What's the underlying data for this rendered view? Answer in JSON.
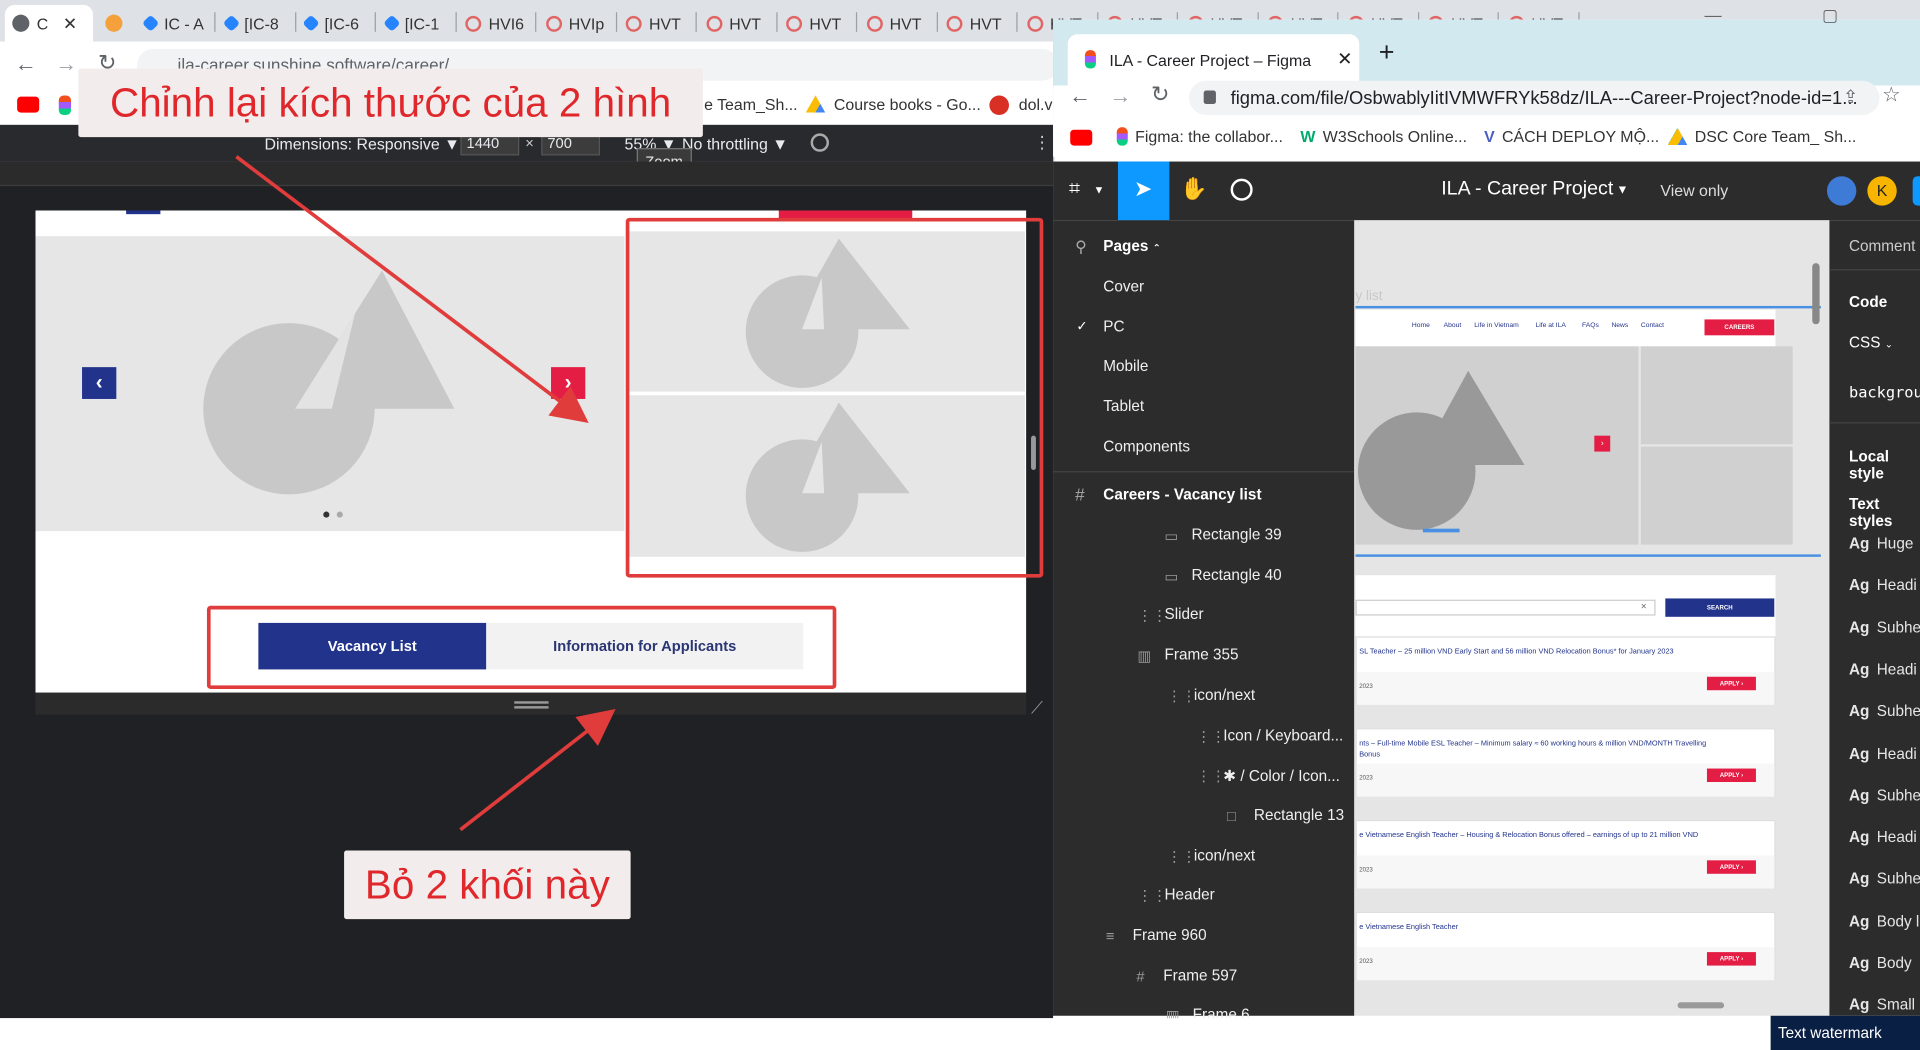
{
  "colors": {
    "accent_red": "#e03c3c",
    "navy": "#22338c",
    "pink": "#e41d44",
    "figma_dark": "#2c2c2c"
  },
  "left_browser": {
    "tabs": [
      "C",
      "IC - A",
      "[IC-8",
      "[IC-6",
      "[IC-1",
      "HVI6",
      "HVIp",
      "HVT",
      "HVT",
      "HVT",
      "HVT",
      "HVT",
      "HVT",
      "HVT",
      "HVT",
      "HVT",
      "HVT",
      "HVT",
      "HVT"
    ],
    "url": "ila-career.sunshine.software/career/",
    "bookmarks": [
      "e Team_Sh...",
      "Course books - Go...",
      "dol.vn"
    ],
    "devtools": {
      "dimensions": "Dimensions: Responsive ▼",
      "width": "1440",
      "height": "700",
      "zoom": "55% ▼",
      "throttle": "No throttling ▼",
      "zoom_tooltip": "Zoom"
    },
    "page": {
      "nav_prev": "‹",
      "nav_next": "›",
      "tab_vacancy": "Vacancy List",
      "tab_info": "Information for Applicants"
    }
  },
  "annotations": {
    "top": "Chỉnh lại kích thước của 2 hình",
    "bottom": "Bỏ 2 khối này"
  },
  "right_browser": {
    "tab_title": "ILA - Career Project – Figma",
    "new_tab": "+",
    "url": "figma.com/file/OsbwablyIitIVMWFRYk58dz/ILA---Career-Project?node-id=1...",
    "bookmarks": [
      "Figma: the collabor...",
      "W3Schools Online...",
      "CÁCH DEPLOY MỘ...",
      "DSC Core Team_ Sh..."
    ],
    "figma": {
      "project": "ILA - Career Project",
      "view_only": "View only",
      "avatar_letter": "K",
      "pages_label": "Pages",
      "pages": [
        "Cover",
        "PC",
        "Mobile",
        "Tablet",
        "Components"
      ],
      "frame": "Careers - Vacancy list",
      "layers": [
        "Rectangle 39",
        "Rectangle 40",
        "Slider",
        "Frame 355",
        "icon/next",
        "Icon / Keyboard...",
        "✱ / Color / Icon...",
        "Rectangle 13",
        "icon/next",
        "Header",
        "Frame 960",
        "Frame 597",
        "Frame 6"
      ],
      "right_panel": {
        "comment": "Comment",
        "code": "Code",
        "css": "CSS",
        "background": "backgroun",
        "local_styles": "Local style",
        "text_styles": "Text styles",
        "styles": [
          "Huge",
          "Headi",
          "Subhe",
          "Headi",
          "Subhe",
          "Headi",
          "Subhe",
          "Headi",
          "Subhe",
          "Body l",
          "Body",
          "Small"
        ]
      },
      "canvas": {
        "label": "y list",
        "nav": [
          "Home",
          "About",
          "Life in Vietnam",
          "Life at ILA",
          "FAQs",
          "News",
          "Contact"
        ],
        "careers_btn": "CAREERS",
        "search_btn": "SEARCH",
        "search_clear": "×",
        "jobs": [
          {
            "title": "SL Teacher – 25 million VND Early Start and 56 million VND Relocation Bonus* for January 2023",
            "date": "2023",
            "apply": "APPLY ›"
          },
          {
            "title": "nts – Full-time Mobile ESL Teacher – Minimum salary ≈ 60 working hours & million VND/MONTH Travelling Bonus",
            "date": "2023",
            "apply": "APPLY ›"
          },
          {
            "title": "e Vietnamese English Teacher – Housing & Relocation Bonus offered – earnings of up to 21 million VND",
            "date": "2023",
            "apply": "APPLY ›"
          },
          {
            "title": "e Vietnamese English Teacher",
            "date": "2023",
            "apply": "APPLY ›"
          }
        ]
      }
    }
  },
  "watermark": "Text watermark"
}
